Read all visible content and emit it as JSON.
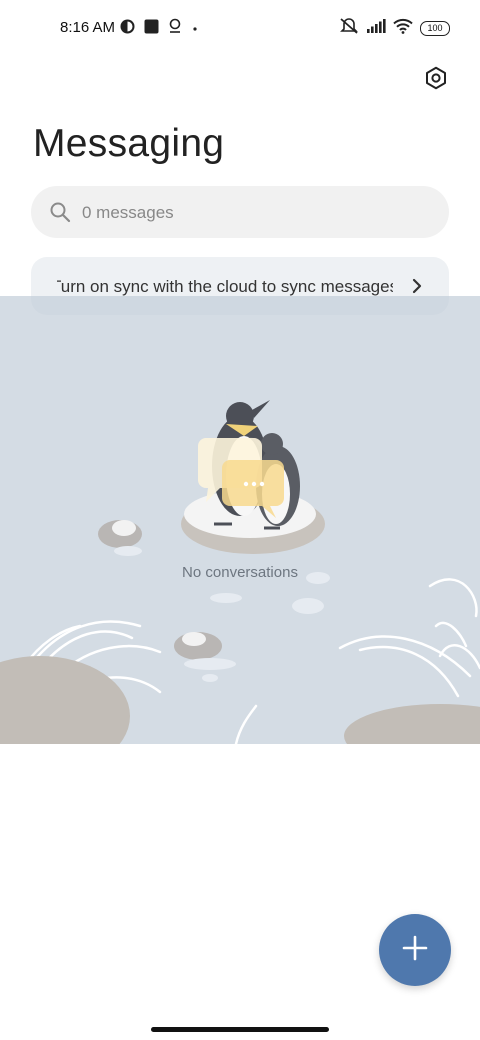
{
  "status_bar": {
    "time": "8:16 AM",
    "battery": "100",
    "icons": [
      "app-notification-icon",
      "square-notification-icon",
      "location-icon",
      "dot-icon",
      "mute-icon",
      "signal-icon",
      "wifi-icon",
      "battery-icon"
    ]
  },
  "header": {
    "title": "Messaging",
    "settings_icon": "settings-hexagon-icon"
  },
  "search": {
    "placeholder": "0 messages"
  },
  "sync_banner": {
    "text": "Turn on sync with the cloud to sync messages"
  },
  "empty_state": {
    "label": "No conversations",
    "illustration": "penguins-on-ice-illustration"
  },
  "fab": {
    "icon": "plus-icon",
    "color": "#4f78ad"
  }
}
